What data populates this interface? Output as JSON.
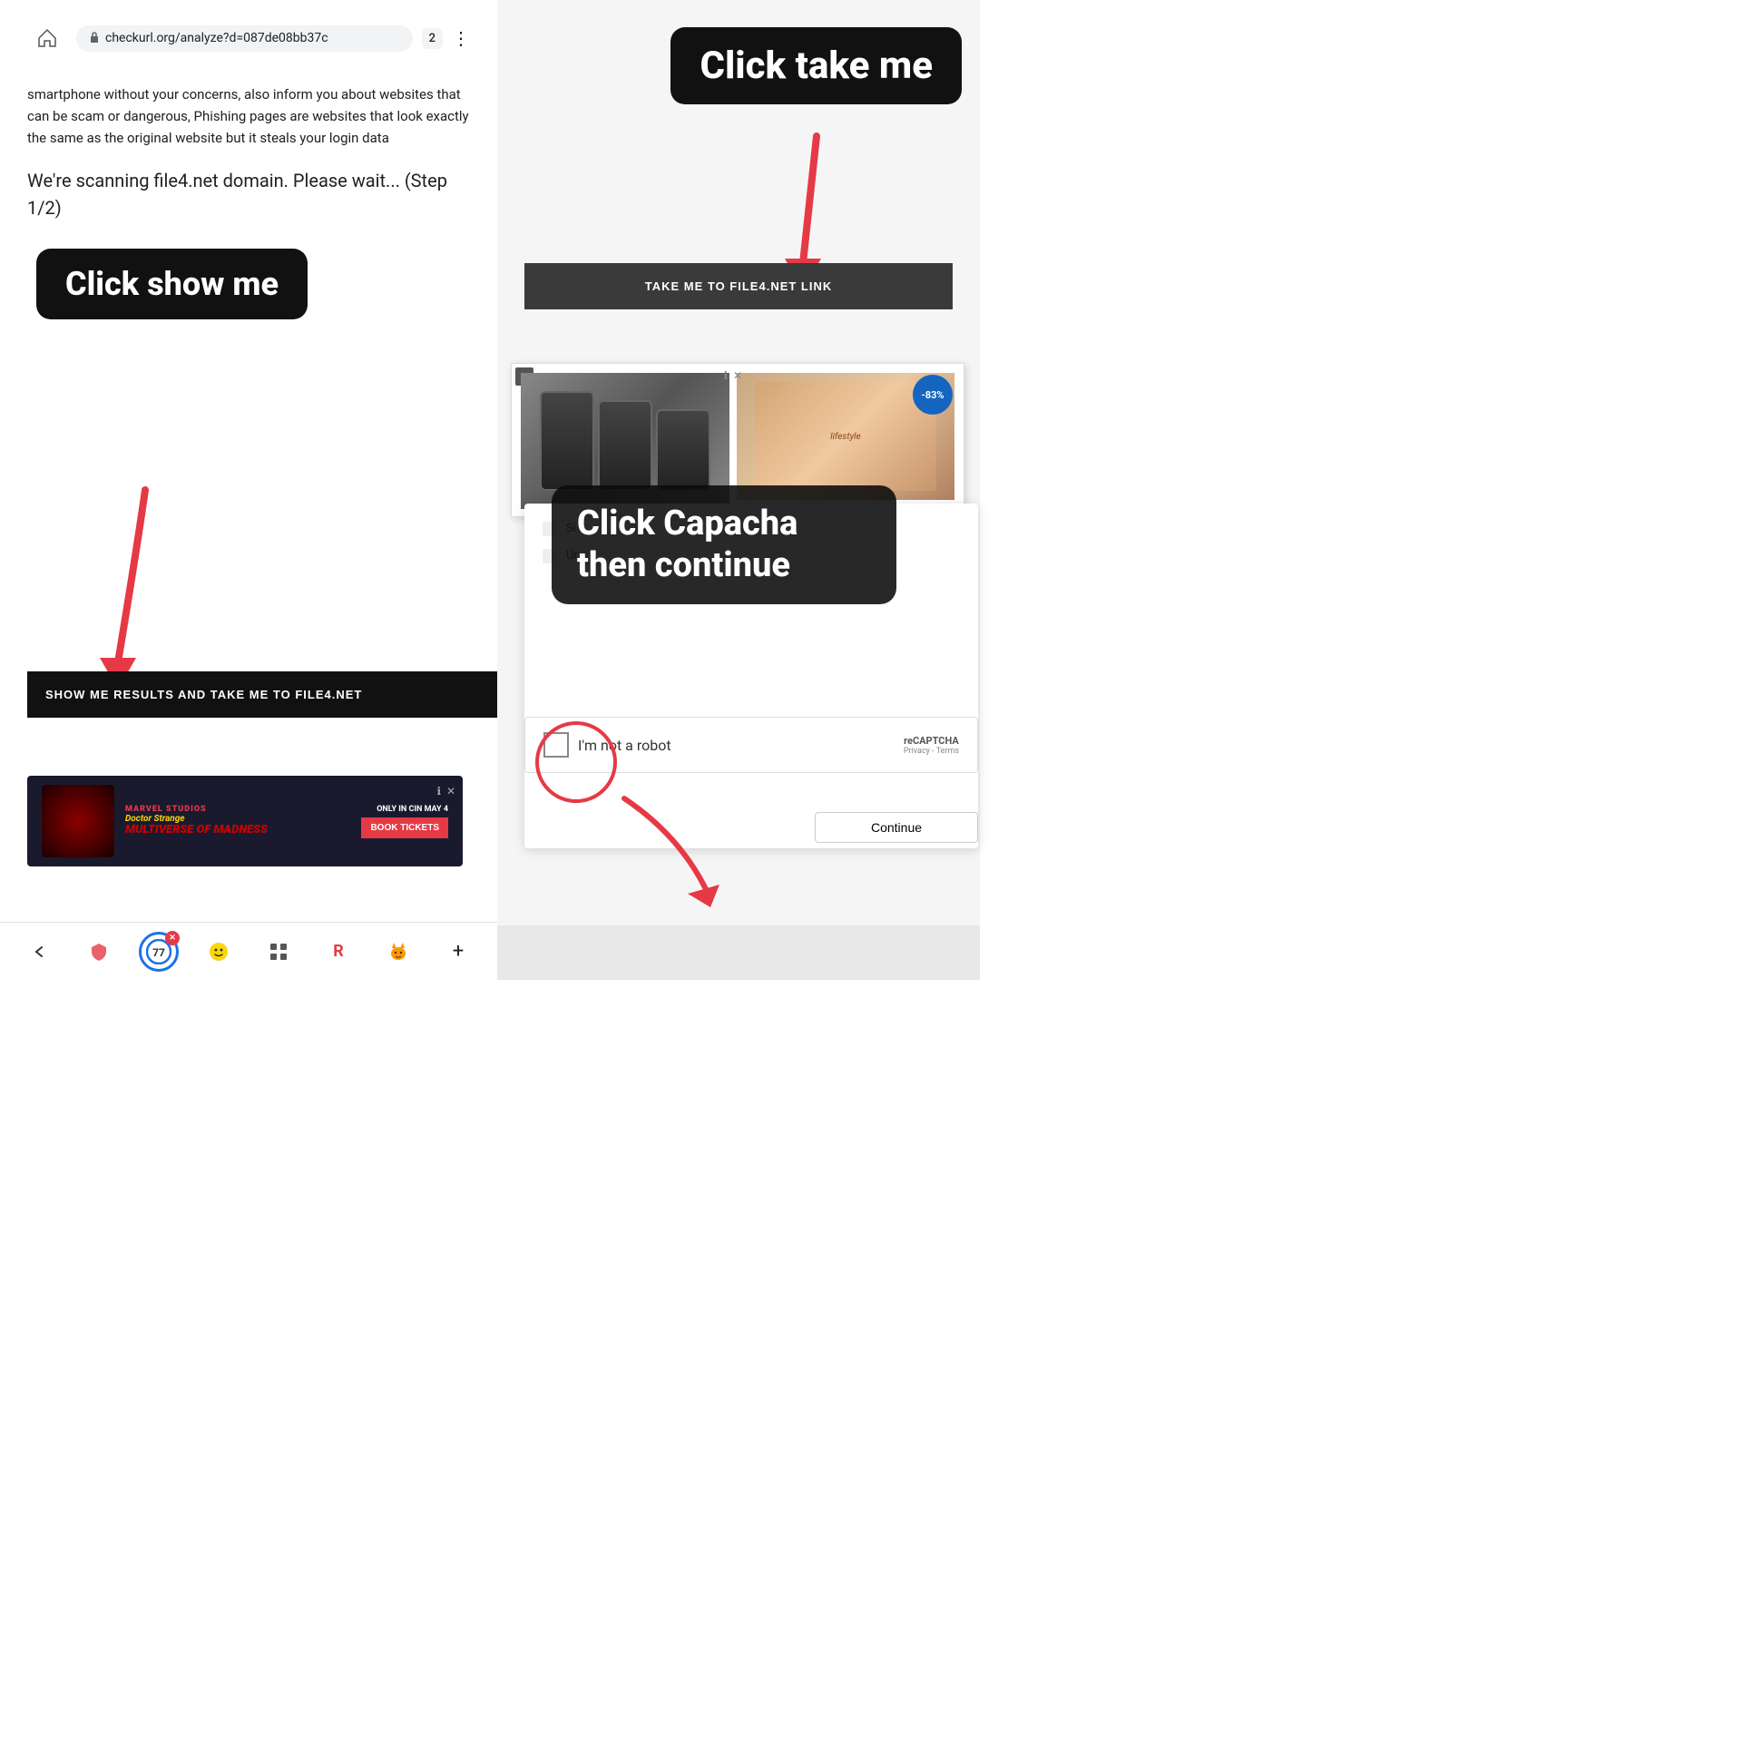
{
  "browser": {
    "url": "checkurl.org/analyze?d=087de08bb37c",
    "tab_count": "2"
  },
  "left_panel": {
    "page_text": "smartphone without your concerns, also inform you about websites that can be scam or dangerous, Phishing pages are websites that look exactly the same as the original website but it steals your login data",
    "scanning_text": "We're scanning file4.net domain. Please wait... (Step 1/2)",
    "click_show_me_label": "Click show me",
    "show_me_btn_label": "SHOW ME RESULTS AND TAKE ME TO FILE4.NET",
    "ad_title": "MULTIVERSE OF MADNESS",
    "ad_subtitle": "Doctor Strange",
    "ad_only_in": "ONLY IN CIN MAY 4",
    "ad_book_tickets": "BOOK TICKETS"
  },
  "right_panel": {
    "click_take_me_label": "Click take me",
    "take_me_btn_label": "TAKE ME TO FILE4.NET LINK",
    "click_capacha_label": "Click Capacha then continue",
    "not_robot_label": "I'm not a robot",
    "recaptcha_label": "reCAPTCHA",
    "recaptcha_sub": "Privacy - Terms",
    "continue_btn_label": "Continue"
  },
  "bottom_nav": {
    "back_label": "‹",
    "forward_label": ""
  },
  "icons": {
    "home": "⌂",
    "lock": "🔒",
    "more": "⋮",
    "close": "✕",
    "plus": "+",
    "tab1": "🛡",
    "tab2": "😊",
    "tab3": "📋",
    "tab4": "R",
    "tab5": "😺"
  }
}
